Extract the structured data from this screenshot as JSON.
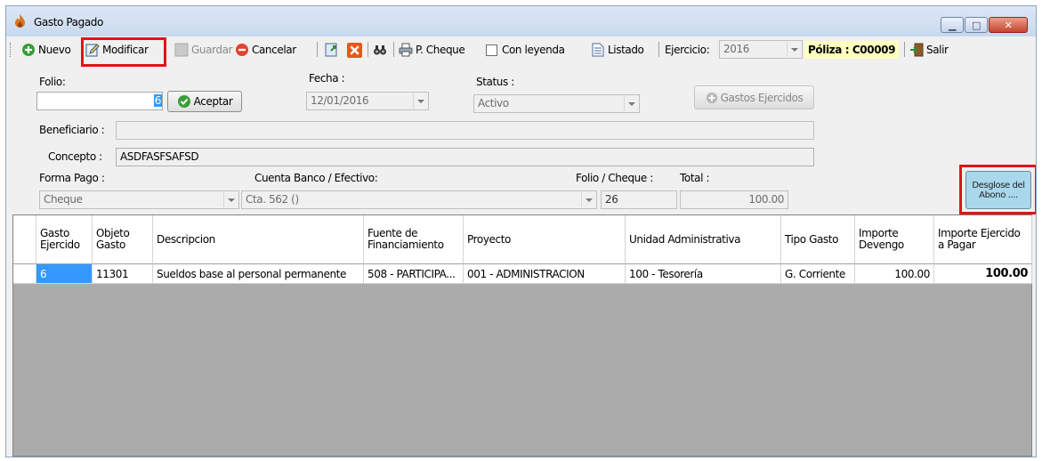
{
  "window": {
    "title": "Gasto Pagado",
    "minimize_glyph": "▁",
    "maximize_glyph": "□",
    "close_glyph": "✕"
  },
  "toolbar": {
    "nuevo": "Nuevo",
    "modificar": "Modificar",
    "guardar": "Guardar",
    "cancelar": "Cancelar",
    "p_cheque": "P. Cheque",
    "con_leyenda": "Con leyenda",
    "listado": "Listado",
    "ejercicio_label": "Ejercicio:",
    "ejercicio_value": "2016",
    "poliza": "Póliza : C00009",
    "salir": "Salir"
  },
  "form": {
    "folio_label": "Folio:",
    "folio_value": "6",
    "aceptar": "Aceptar",
    "fecha_label": "Fecha :",
    "fecha_value": "12/01/2016",
    "status_label": "Status :",
    "status_value": "Activo",
    "gastos_ejercidos": "Gastos Ejercidos",
    "beneficiario_label": "Beneficiario :",
    "beneficiario_value": "",
    "concepto_label": "Concepto :",
    "concepto_value": "ASDFASFSAFSD",
    "forma_pago_label": "Forma Pago :",
    "forma_pago_value": "Cheque",
    "cuenta_label": "Cuenta Banco / Efectivo:",
    "cuenta_value": "Cta. 562 ()",
    "folio_cheque_label": "Folio / Cheque :",
    "folio_cheque_value": "26",
    "total_label": "Total :",
    "total_value": "100.00",
    "desglose_line1": "Desglose del",
    "desglose_line2": "Abono ...."
  },
  "grid": {
    "columns": [
      "Gasto Ejercido",
      "Objeto Gasto",
      "Descripcion",
      "Fuente de Financiamiento",
      "Proyecto",
      "Unidad Administrativa",
      "Tipo Gasto",
      "Importe Devengo",
      "Importe Ejercido a Pagar"
    ],
    "rows": [
      [
        "6",
        "11301",
        "Sueldos base al personal permanente",
        "508 - PARTICIPA...",
        "001 - ADMINISTRACION",
        "100 - Tesorería",
        "G. Corriente",
        "100.00",
        "100.00"
      ]
    ]
  },
  "colors": {
    "highlight_box": "#e0141a",
    "selected_cell": "#3399ff",
    "poliza_bg": "#ffffc0",
    "desglose_bg": "#a9d7ec"
  }
}
